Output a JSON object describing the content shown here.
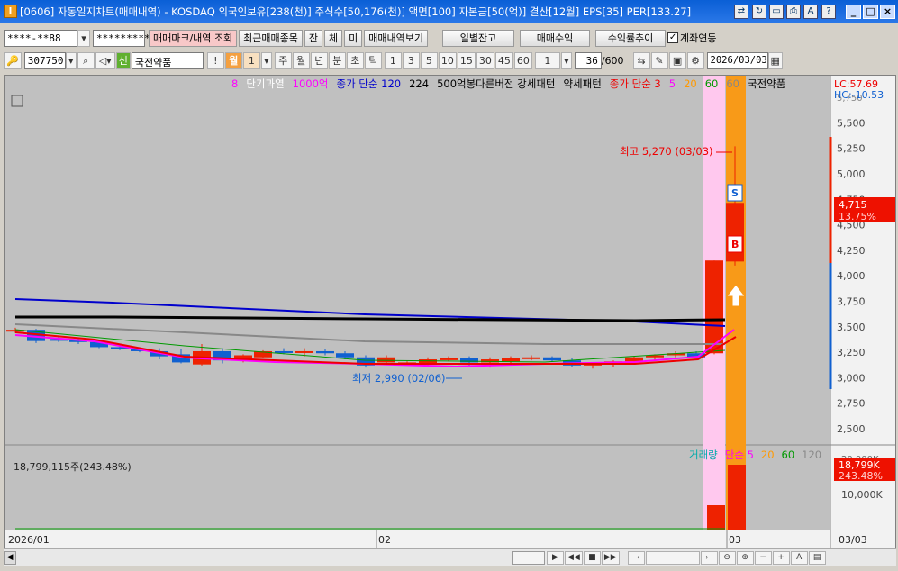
{
  "window": {
    "title": "[0606] 자동일지차트(매매내역) - KOSDAQ 외국인보유[238(천)] 주식수[50,176(천)] 액면[100] 자본금[50(억)] 결산[12월] EPS[35] PER[133.27]",
    "app_icon": "I"
  },
  "row1": {
    "account": "****-**88",
    "password": "*********",
    "btn_trade_mark": "매매마크/내역 조회",
    "btn_recent": "최근매매종목",
    "btn_jan": "잔",
    "btn_che": "체",
    "btn_mi": "미",
    "btn_view_trades": "매매내역보기",
    "btn_daily_balance": "일별잔고",
    "btn_profit": "매매수익",
    "btn_return_trend": "수익률추이",
    "chk_link": "계좌연동"
  },
  "row2": {
    "code": "307750",
    "badge": "신",
    "stock_name": "국전약품",
    "excl": "!",
    "period_sel": "월",
    "period_num": "1",
    "periods": [
      "주",
      "월",
      "년",
      "분",
      "초",
      "틱"
    ],
    "intervals": [
      "1",
      "3",
      "5",
      "10",
      "15",
      "30",
      "45",
      "60"
    ],
    "custom_interval": "1",
    "count": "36",
    "count_max": "/600",
    "date": "2026/03/03"
  },
  "legend_top": [
    {
      "text": "8",
      "color": "#ff00ff"
    },
    {
      "text": "단기과열",
      "color": "#ffffff"
    },
    {
      "text": "1000억",
      "color": "#ff00ff"
    },
    {
      "text": "종가 단순 120",
      "color": "#0000cc"
    },
    {
      "text": "224",
      "color": "#000000"
    },
    {
      "text": "500억봉다른버전 강세패턴",
      "color": "#000000"
    },
    {
      "text": "약세패턴",
      "color": "#000000"
    },
    {
      "text": "종가 단순 3",
      "color": "#ee0000"
    },
    {
      "text": "5",
      "color": "#ff00ff"
    },
    {
      "text": "20",
      "color": "#ff9900"
    },
    {
      "text": "60",
      "color": "#009900"
    },
    {
      "text": "60",
      "color": "#888888"
    },
    {
      "text": "국전약품",
      "color": "#000000"
    }
  ],
  "lc_label": "LC:57.69",
  "hc_label": "HC:-10.53",
  "price_labels": [
    "5,500",
    "5,250",
    "5,000",
    "4,750",
    "4,500",
    "4,250",
    "4,000",
    "3,750",
    "3,500",
    "3,250",
    "3,000",
    "2,750",
    "2,500"
  ],
  "price_scale_top": "5,750",
  "current_price": "4,715",
  "current_change": "13.75%",
  "high_label": "최고 5,270 (03/03)",
  "low_label": "최저 2,990 (02/06)",
  "marker_s": "S",
  "marker_b": "B",
  "volume_legend": [
    {
      "text": "거래량",
      "color": "#00aaaa"
    },
    {
      "text": "단순 5",
      "color": "#ff00ff"
    },
    {
      "text": "20",
      "color": "#ff9900"
    },
    {
      "text": "60",
      "color": "#009900"
    },
    {
      "text": "120",
      "color": "#888888"
    }
  ],
  "volume_info": "18,799,115주(243.48%)",
  "volume_scale_top": "20,000K",
  "volume_current": "18,799K",
  "volume_pct": "243.48%",
  "volume_mid_label": "10,000K",
  "x_labels": [
    "2026/01",
    "02",
    "03"
  ],
  "x_end_label": "03/03",
  "chart_colors": {
    "up": "#ee2200",
    "down": "#1060d0",
    "bg": "#c0c0c0"
  }
}
